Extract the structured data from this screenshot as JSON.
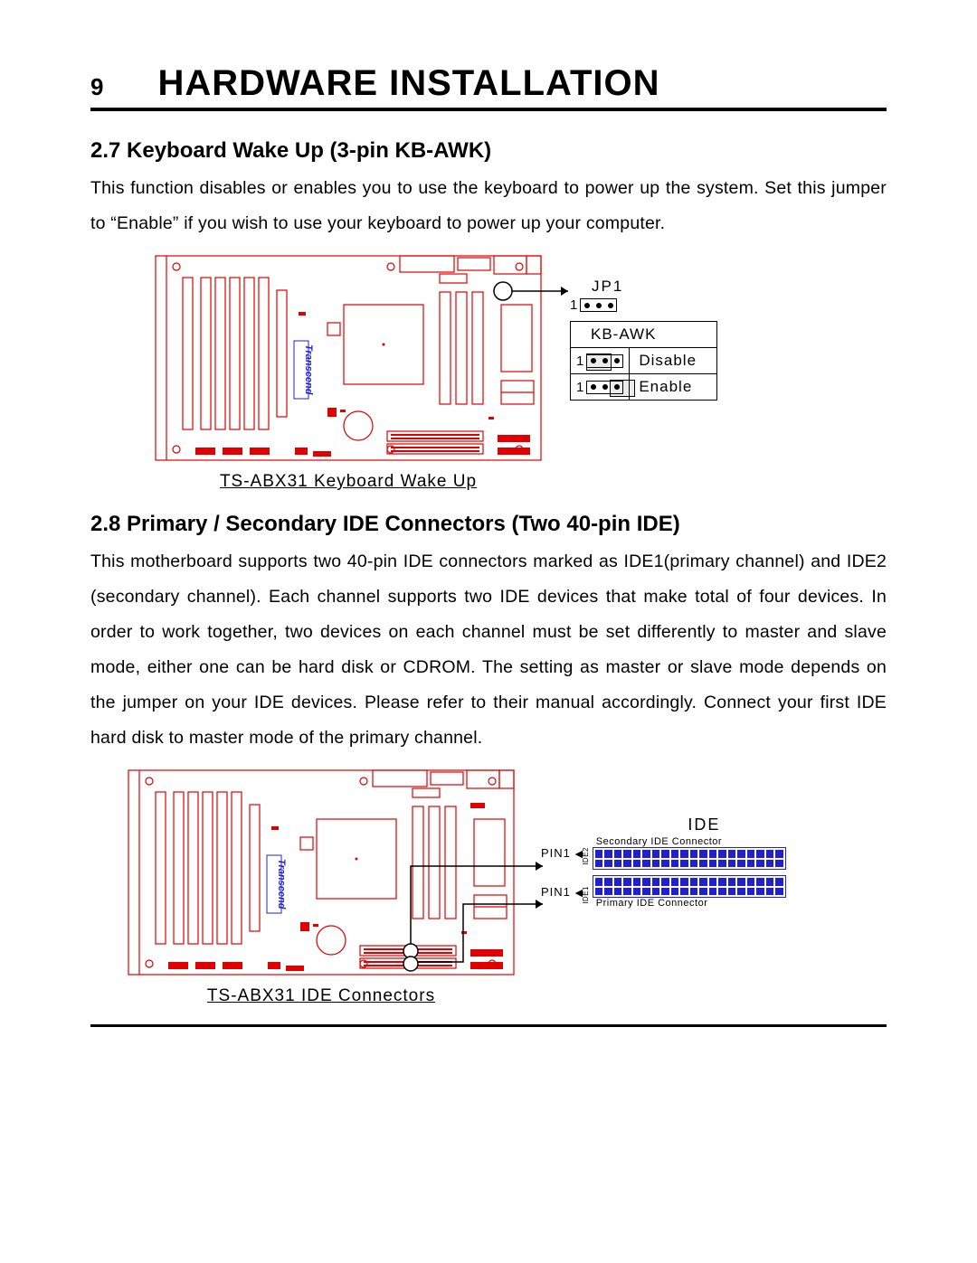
{
  "page_number": "9",
  "chapter_title": "HARDWARE INSTALLATION",
  "section27": {
    "heading": "2.7 Keyboard Wake Up (3-pin KB-AWK)",
    "body": "This function disables or enables you to use the keyboard to power up the system. Set this jumper to “Enable” if you wish to use your keyboard to power up your computer.",
    "caption": "TS-ABX31 Keyboard Wake Up",
    "jp_label": "JP1",
    "table_header": "KB-AWK",
    "row1": "Disable",
    "row2": "Enable",
    "pin_one": "1",
    "brand": "Transcend"
  },
  "section28": {
    "heading": "2.8 Primary / Secondary IDE Connectors (Two 40-pin IDE)",
    "body": "This motherboard supports two 40-pin IDE connectors marked as IDE1(primary channel) and IDE2 (secondary channel). Each channel supports two IDE devices that make total of four devices. In order to work together, two devices on each channel must be set differently to master and slave mode, either one can be hard disk or CDROM. The setting as master or slave mode depends on the jumper on your IDE devices. Please refer to their manual accordingly. Connect your first IDE hard disk to master mode of the primary channel.",
    "caption": "TS-ABX31 IDE Connectors",
    "ide_title": "IDE",
    "pin1": "PIN1",
    "sec_label": "Secondary IDE Connector",
    "pri_label": "Primary IDE Connector",
    "ide2": "IDE2",
    "ide1": "IDE1",
    "brand": "Transcend"
  }
}
